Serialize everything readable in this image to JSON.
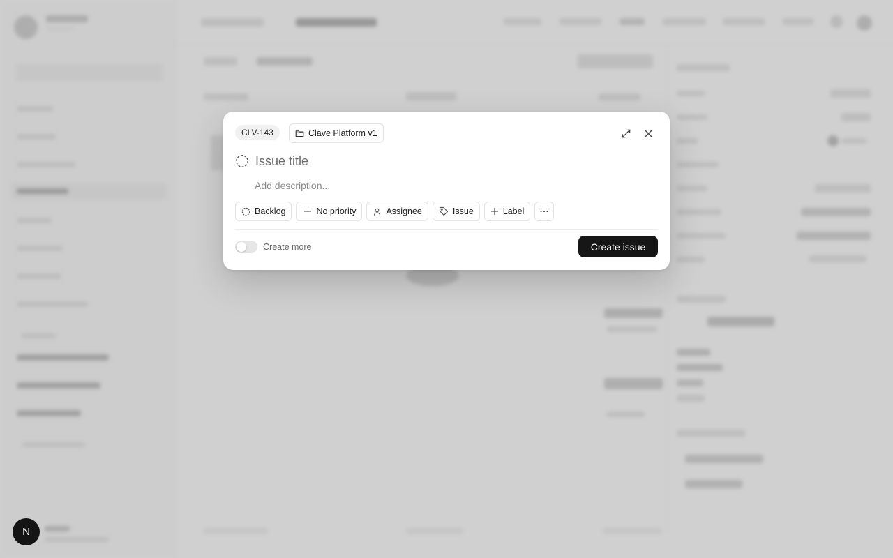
{
  "modal": {
    "issue_id": "CLV-143",
    "project": "Clave Platform v1",
    "title_placeholder": "Issue title",
    "description_placeholder": "Add description...",
    "properties": {
      "status": "Backlog",
      "priority": "No priority",
      "assignee": "Assignee",
      "type": "Issue",
      "label": "Label"
    },
    "create_more_label": "Create more",
    "create_button_label": "Create issue"
  },
  "user_avatar_initial": "N",
  "icons": {
    "project": "folder-icon",
    "expand": "expand-icon",
    "close": "close-icon",
    "status": "dashed-circle-icon",
    "priority": "dash-icon",
    "assignee": "user-icon",
    "type": "tag-icon",
    "label": "plus-icon",
    "more": "ellipsis-icon"
  }
}
